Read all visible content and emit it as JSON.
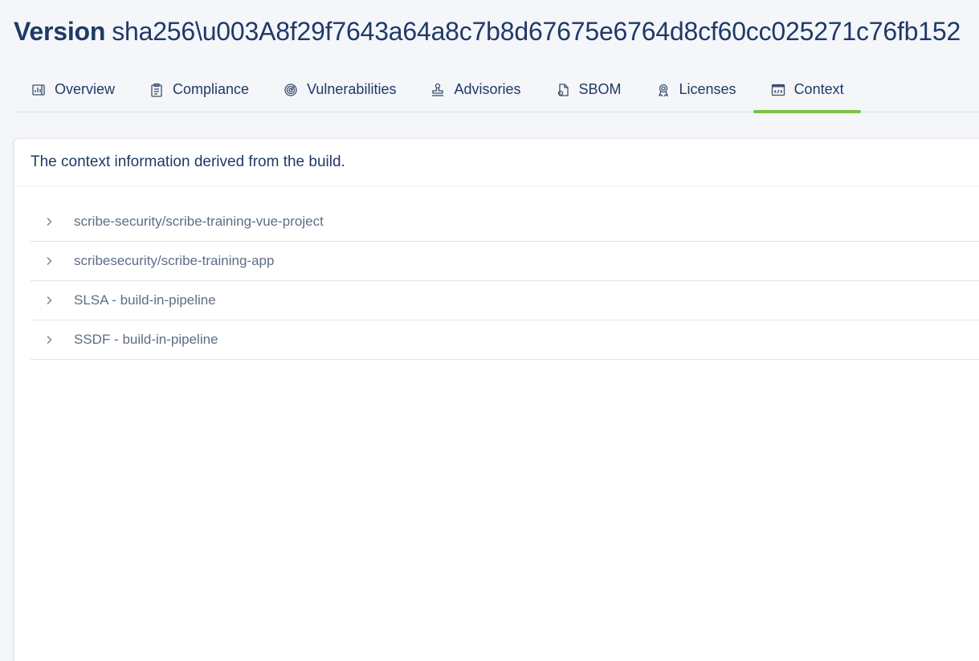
{
  "header": {
    "title_label": "Version",
    "title_value": "sha256\\u003A8f29f7643a64a8c7b8d67675e6764d8cf60cc025271c76fb152"
  },
  "tabs": [
    {
      "label": "Overview",
      "icon": "overview-icon",
      "active": false
    },
    {
      "label": "Compliance",
      "icon": "clipboard-icon",
      "active": false
    },
    {
      "label": "Vulnerabilities",
      "icon": "radar-icon",
      "active": false
    },
    {
      "label": "Advisories",
      "icon": "stamp-icon",
      "active": false
    },
    {
      "label": "SBOM",
      "icon": "document-icon",
      "active": false
    },
    {
      "label": "Licenses",
      "icon": "award-icon",
      "active": false
    },
    {
      "label": "Context",
      "icon": "code-window-icon",
      "active": true
    }
  ],
  "context_card": {
    "heading": "The context information derived from the build.",
    "items": [
      {
        "label": "scribe-security/scribe-training-vue-project"
      },
      {
        "label": "scribesecurity/scribe-training-app"
      },
      {
        "label": "SLSA - build-in-pipeline"
      },
      {
        "label": "SSDF - build-in-pipeline"
      }
    ]
  },
  "colors": {
    "text_primary": "#1f3a66",
    "text_secondary": "#5d6e86",
    "active_tab_underline": "#7bc043",
    "divider": "#dfe3ea"
  }
}
